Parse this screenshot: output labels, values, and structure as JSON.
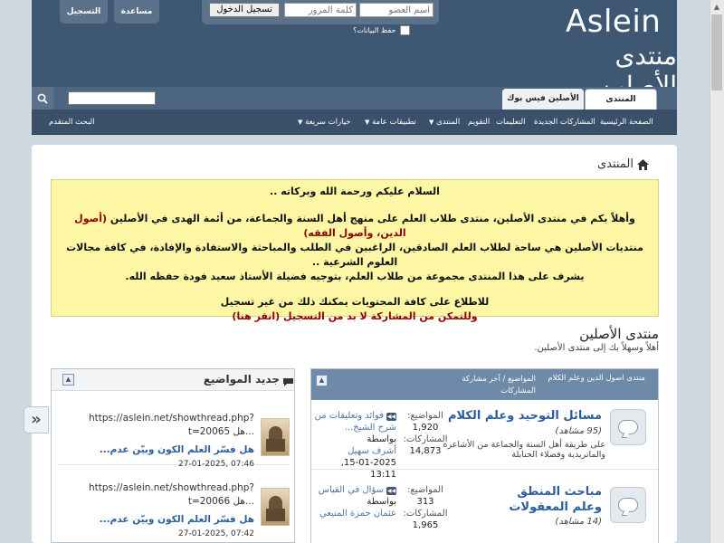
{
  "header": {
    "logo_en": "Aslein",
    "logo_ar": "منتدى الأصلين",
    "login": {
      "username_placeholder": "اسم العضو",
      "password_placeholder": "كلمة المرور",
      "login_button": "تسجيل الدخول",
      "remember_me": "حفظ البيانات؟"
    },
    "help_button": "مساعدة",
    "register_button": "التسجيل"
  },
  "navbar": {
    "tabs": [
      {
        "label": "المنتدى",
        "active": true
      },
      {
        "label": "الأصلين فيس بوك",
        "active": false
      }
    ],
    "search_value": ""
  },
  "subnav": {
    "links": [
      "الصفحة الرئيسية",
      "المشاركات الجديدة",
      "التعليمات",
      "التقويم",
      "المنتدى",
      "تطبيقات عامة",
      "خيارات سريعة"
    ],
    "advanced_search": "البحث المتقدم"
  },
  "breadcrumb": {
    "home_icon": "home-icon",
    "label": "المنتدى"
  },
  "notice": {
    "lines": [
      "السلام عليكم ورحمة الله وبركاته ..",
      "وأهلاً بكم في منتدى الأصلين، منتدى طلاب العلم على منهج أهل السنة والجماعة، من أئمة الهدى في الأصلين",
      "(أصول الدين، وأصول الفقه)",
      "منتديات الأصلين هي ساحة لطلاب العلم الصادقين، الراغبين في الطلب والمباحثة والاستفادة والإفادة، في كافة مجالات العلوم الشرعية ..",
      "يشرف على هذا المنتدى مجموعة من طلاب العلم، بتوجيه فضيلة الأستاذ سعيد فودة حفظه الله.",
      "للاطلاع على كافة المحتويات يمكنك ذلك من غير تسجيل",
      "وللتمكن من المشاركة لا بد من التسجيل (انقر هنا)"
    ]
  },
  "forum_home": {
    "title": "منتدى الأصلين",
    "subtitle": "أهلاً وسهلاً بك إلى منتدى الأصلين."
  },
  "sidebar": {
    "title": "جديد المواضيع",
    "items": [
      {
        "url": "https://aslein.net/showthread.php?",
        "url_cont": "t=20065 هل...",
        "title": "هل فسّر العلم الكون وبيّن عدم...",
        "date": "27-01-2025, 07:46"
      },
      {
        "url": "https://aslein.net/showthread.php?",
        "url_cont": "t=20066 هل...",
        "title": "هل فسّر العلم الكون وبيّن عدم...",
        "date": "27-01-2025, 07:42"
      }
    ]
  },
  "forum_table": {
    "header_name": "منتدى اصول الدين وعلم الكلام",
    "header_stats": "المواضيع / آخر مشاركة",
    "header_stats2": "المشاركات",
    "forums": [
      {
        "name": "مسائل التوحيد وعلم الكلام",
        "views": "(95 مشاهد)",
        "desc": "على طريقة أهل السنة والجماعة من الأشاعرة والماتريدية وفضلاء الحنابلة",
        "topics_label": "المواضيع:",
        "topics": "1,920",
        "posts_label": "المشاركات:",
        "posts": "14,873",
        "last_title": "فوائد وتعليقات من شرح الشيخ...",
        "last_by_label": "بواسطة",
        "last_user": "أشرف سهيل",
        "last_date": "15-01-2025, 13:11"
      },
      {
        "name": "مباحث المنطق وعلم المعقولات",
        "views": "(14 مشاهد)",
        "desc": "",
        "topics_label": "المواضيع:",
        "topics": "313",
        "posts_label": "المشاركات:",
        "posts": "1,965",
        "last_title": "سؤال في القياس",
        "last_by_label": "بواسطة",
        "last_user": "عثمان حمزة المنيعي",
        "last_date": ""
      }
    ]
  },
  "colors": {
    "header_bg": "#3e5873",
    "accent_link": "#2b5e9c",
    "notice_bg": "#fdf6a4"
  }
}
